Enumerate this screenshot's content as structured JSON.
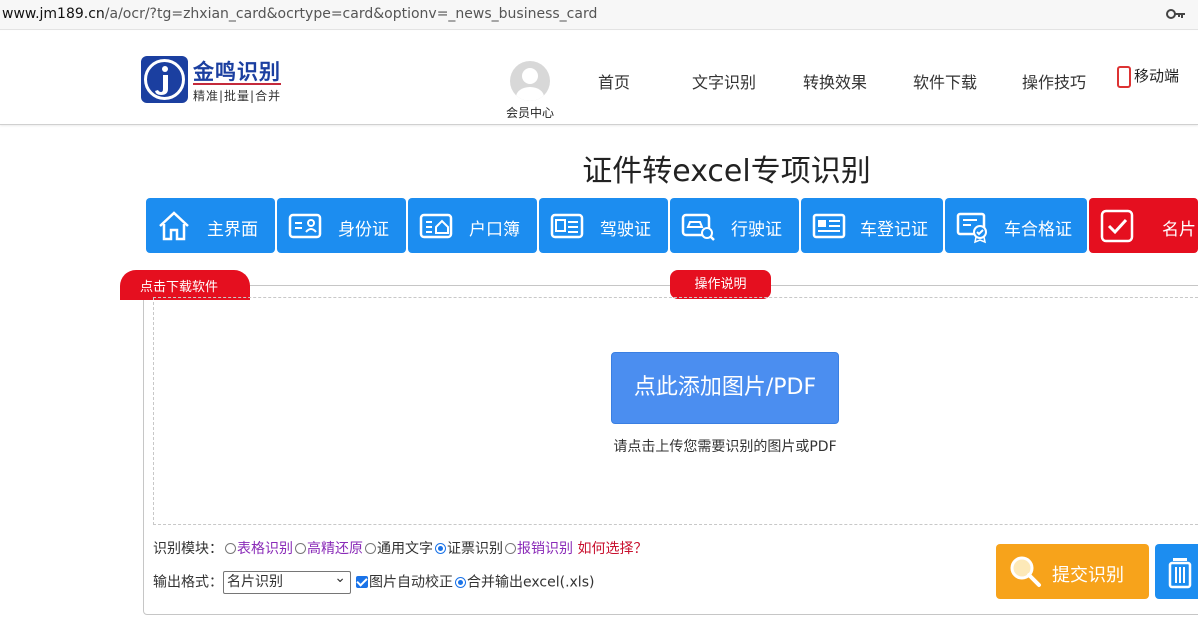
{
  "browser": {
    "url_host": "www.jm189.cn",
    "url_path": "/a/ocr/?tg=zhxian_card&ocrtype=card&optionv=_news_business_card"
  },
  "header": {
    "logo_title": "金鸣识别",
    "logo_slogan": "精准|批量|合并",
    "member_label": "会员中心",
    "nav": [
      "首页",
      "文字识别",
      "转换效果",
      "软件下载",
      "操作技巧"
    ],
    "mobile_label": "移动端"
  },
  "page_title": "证件转excel专项识别",
  "tabs": [
    {
      "label": "主界面",
      "icon": "home-icon"
    },
    {
      "label": "身份证",
      "icon": "id-card-icon"
    },
    {
      "label": "户口簿",
      "icon": "household-book-icon"
    },
    {
      "label": "驾驶证",
      "icon": "driver-license-icon"
    },
    {
      "label": "行驶证",
      "icon": "vehicle-license-icon"
    },
    {
      "label": "车登记证",
      "icon": "vehicle-registration-icon"
    },
    {
      "label": "车合格证",
      "icon": "vehicle-certificate-icon"
    },
    {
      "label": "名片",
      "icon": "checkmark-icon"
    }
  ],
  "colors": {
    "tab_blue": "#1c8df0",
    "tab_active_red": "#e50f1f",
    "submit_orange": "#f7a31b",
    "add_button_blue": "#4b8ef0"
  },
  "upload": {
    "download_label": "点击下载软件",
    "help_label": "操作说明",
    "add_button": "点此添加图片/PDF",
    "hint": "请点击上传您需要识别的图片或PDF"
  },
  "options": {
    "module_label": "识别模块：",
    "modules": [
      {
        "label": "表格识别",
        "selected": false,
        "style": "purple"
      },
      {
        "label": "高精还原",
        "selected": false,
        "style": "purple"
      },
      {
        "label": "通用文字",
        "selected": false,
        "style": "plain"
      },
      {
        "label": "证票识别",
        "selected": true,
        "style": "plain"
      },
      {
        "label": "报销识别",
        "selected": false,
        "style": "purple"
      }
    ],
    "how_to_choose": "如何选择？",
    "output_label": "输出格式：",
    "output_value": "名片识别",
    "auto_correct": "图片自动校正",
    "merge_output": "合并输出excel(.xls)"
  },
  "actions": {
    "submit": "提交识别"
  }
}
